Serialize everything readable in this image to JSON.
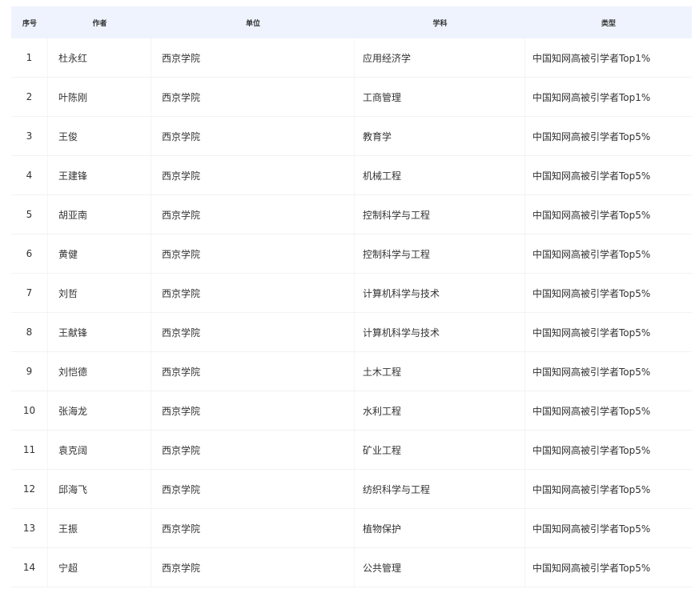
{
  "table": {
    "headers": {
      "index": "序号",
      "author": "作者",
      "unit": "单位",
      "subject": "学科",
      "type": "类型"
    },
    "rows": [
      {
        "index": "1",
        "author": "杜永红",
        "unit": "西京学院",
        "subject": "应用经济学",
        "type": "中国知网高被引学者Top1%"
      },
      {
        "index": "2",
        "author": "叶陈刚",
        "unit": "西京学院",
        "subject": "工商管理",
        "type": "中国知网高被引学者Top1%"
      },
      {
        "index": "3",
        "author": "王俊",
        "unit": "西京学院",
        "subject": "教育学",
        "type": "中国知网高被引学者Top5%"
      },
      {
        "index": "4",
        "author": "王建锋",
        "unit": "西京学院",
        "subject": "机械工程",
        "type": "中国知网高被引学者Top5%"
      },
      {
        "index": "5",
        "author": "胡亚南",
        "unit": "西京学院",
        "subject": "控制科学与工程",
        "type": "中国知网高被引学者Top5%"
      },
      {
        "index": "6",
        "author": "黄健",
        "unit": "西京学院",
        "subject": "控制科学与工程",
        "type": "中国知网高被引学者Top5%"
      },
      {
        "index": "7",
        "author": "刘哲",
        "unit": "西京学院",
        "subject": "计算机科学与技术",
        "type": "中国知网高被引学者Top5%"
      },
      {
        "index": "8",
        "author": "王献锋",
        "unit": "西京学院",
        "subject": "计算机科学与技术",
        "type": "中国知网高被引学者Top5%"
      },
      {
        "index": "9",
        "author": "刘恺德",
        "unit": "西京学院",
        "subject": "土木工程",
        "type": "中国知网高被引学者Top5%"
      },
      {
        "index": "10",
        "author": "张海龙",
        "unit": "西京学院",
        "subject": "水利工程",
        "type": "中国知网高被引学者Top5%"
      },
      {
        "index": "11",
        "author": "袁克阔",
        "unit": "西京学院",
        "subject": "矿业工程",
        "type": "中国知网高被引学者Top5%"
      },
      {
        "index": "12",
        "author": "邱海飞",
        "unit": "西京学院",
        "subject": "纺织科学与工程",
        "type": "中国知网高被引学者Top5%"
      },
      {
        "index": "13",
        "author": "王振",
        "unit": "西京学院",
        "subject": "植物保护",
        "type": "中国知网高被引学者Top5%"
      },
      {
        "index": "14",
        "author": "宁超",
        "unit": "西京学院",
        "subject": "公共管理",
        "type": "中国知网高被引学者Top5%"
      }
    ]
  },
  "colors": {
    "header_bg": "#eef3fe",
    "text": "#333333",
    "row_divider": "#f2f2f2"
  }
}
